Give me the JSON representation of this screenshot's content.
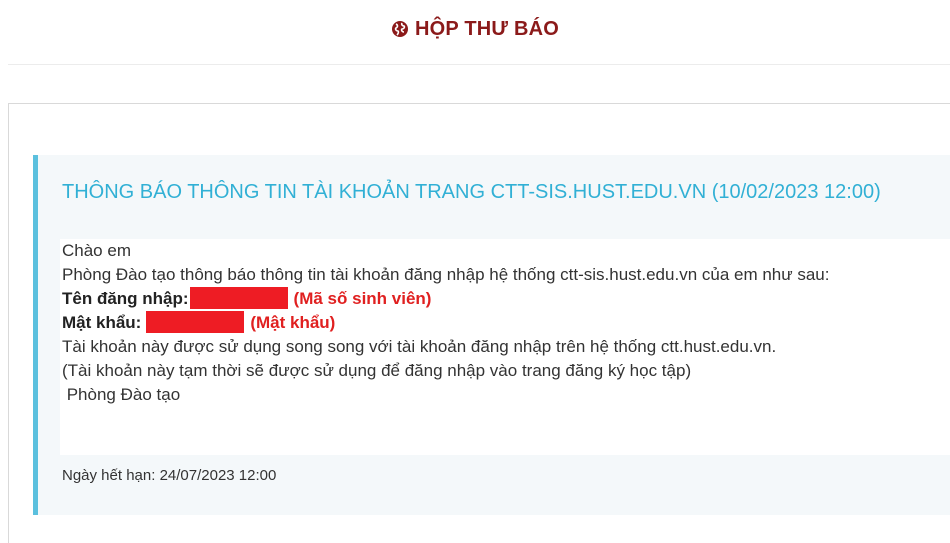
{
  "header": {
    "title": "HỘP THƯ BÁO",
    "icon": "globe-icon"
  },
  "notice": {
    "title": "THÔNG BÁO THÔNG TIN TÀI KHOẢN TRANG CTT-SIS.HUST.EDU.VN (10/02/2023 12:00)",
    "greeting": "Chào em",
    "intro": "Phòng Đào tạo thông báo thông tin tài khoản đăng nhập hệ thống ctt-sis.hust.edu.vn của em như sau:",
    "username_label": "Tên đăng nhập:",
    "username_hint": "(Mã số sinh viên)",
    "password_label": "Mật khẩu:",
    "password_hint": "(Mật khẩu)",
    "line_parallel": "Tài khoản này được sử dụng song song với tài khoản đăng nhập trên hệ thống ctt.hust.edu.vn.",
    "line_temporary": "(Tài khoản này tạm thời sẽ được sử dụng để đăng nhập vào trang đăng ký học tập)",
    "signature": " Phòng Đào tạo",
    "expiry": "Ngày hết hạn: 24/07/2023 12:00"
  },
  "colors": {
    "header": "#8b1a1a",
    "accent": "#5bc0de",
    "redaction": "#ee1c24",
    "hint": "#e02020"
  }
}
